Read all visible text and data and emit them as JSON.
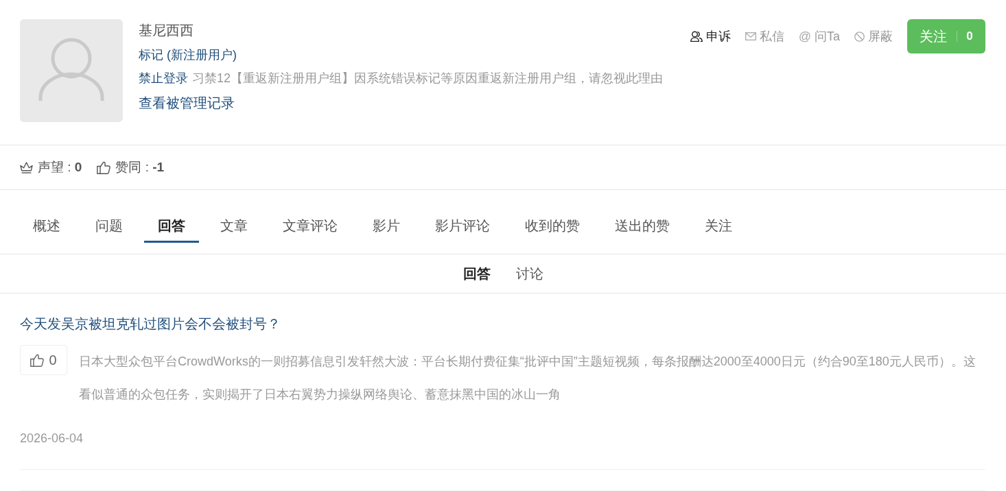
{
  "profile": {
    "name": "基尼西西",
    "group_tag": "标记 (新注册用户)",
    "ban": {
      "label": "禁止登录",
      "reason": "习禁12【重返新注册用户组】因系统错误标记等原因重返新注册用户组，请忽视此理由"
    },
    "records_link": "查看被管理记录"
  },
  "actions": [
    {
      "kind": "appeal",
      "label": "申诉",
      "emphasized": true
    },
    {
      "kind": "message",
      "label": "私信",
      "emphasized": false
    },
    {
      "kind": "ask",
      "glyph": "@",
      "label": "问Ta",
      "emphasized": false
    },
    {
      "kind": "block",
      "label": "屏蔽",
      "emphasized": false
    }
  ],
  "follow_button": {
    "label": "关注",
    "count": "0"
  },
  "stats": [
    {
      "kind": "reputation",
      "text": "声望 : **0**"
    },
    {
      "kind": "agree",
      "text": "赞同 : **-1**"
    }
  ],
  "tabs": [
    {
      "label": "概述",
      "selected": false
    },
    {
      "label": "问题",
      "selected": false
    },
    {
      "label": "回答",
      "selected": true
    },
    {
      "label": "文章",
      "selected": false
    },
    {
      "label": "文章评论",
      "selected": false
    },
    {
      "label": "影片",
      "selected": false
    },
    {
      "label": "影片评论",
      "selected": false
    },
    {
      "label": "收到的赞",
      "selected": false
    },
    {
      "label": "送出的赞",
      "selected": false
    },
    {
      "label": "关注",
      "selected": false
    }
  ],
  "sub_tabs": [
    {
      "label": "回答",
      "selected": true
    },
    {
      "label": "讨论",
      "selected": false
    }
  ],
  "answers": [
    {
      "title": "今天发吴京被坦克轧过图片会不会被封号？",
      "likes": "0",
      "excerpt": "日本大型众包平台CrowdWorks的一则招募信息引发轩然大波：平台长期付费征集“批评中国”主题短视频，每条报酬达2000至4000日元（约合90至180元人民币）。这看似普通的众包任务，实则揭开了日本右翼势力操纵网络舆论、蓄意抹黑中国的冰山一角",
      "date": "2026-06-04"
    }
  ]
}
